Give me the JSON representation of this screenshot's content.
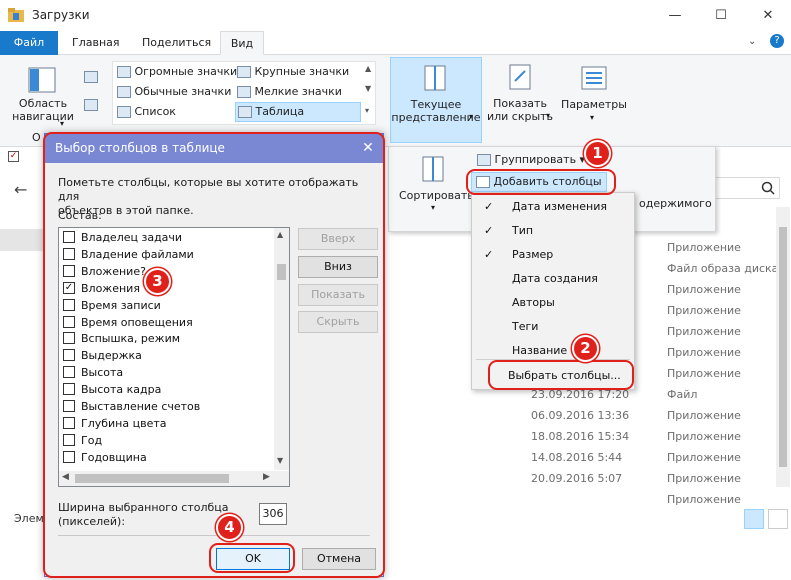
{
  "window": {
    "title": "Загрузки"
  },
  "tabs": [
    "Файл",
    "Главная",
    "Поделиться",
    "Вид"
  ],
  "ribbon": {
    "nav_pane": "Область\nнавигации",
    "nav_group_short": "О",
    "layouts": [
      "Огромные значки",
      "Крупные значки",
      "Обычные значки",
      "Мелкие значки",
      "Список",
      "Таблица"
    ],
    "current_view": "Текущее\nпредставление",
    "show_hide": "Показать\nили скрыть",
    "options": "Параметры"
  },
  "view_dropdown": {
    "sort": "Сортировать",
    "group": "Группировать",
    "add_columns": "Добавить столбцы",
    "contents_partial": "одержимого"
  },
  "menu": {
    "items": [
      {
        "label": "Дата изменения",
        "checked": true
      },
      {
        "label": "Тип",
        "checked": true
      },
      {
        "label": "Размер",
        "checked": true
      },
      {
        "label": "Дата создания",
        "checked": false
      },
      {
        "label": "Авторы",
        "checked": false
      },
      {
        "label": "Теги",
        "checked": false
      },
      {
        "label": "Название",
        "checked": false
      }
    ],
    "choose": "Выбрать столбцы..."
  },
  "files": {
    "types": [
      "Приложение",
      "Файл образа диска",
      "Приложение",
      "Приложение",
      "Приложение",
      "Приложение",
      "Приложение",
      "Файл",
      "Приложение",
      "Приложение",
      "Приложение",
      "Приложение",
      "Приложение"
    ],
    "dates": [
      "23.09.2016 17:20",
      "06.09.2016 13:36",
      "18.08.2016 15:34",
      "14.08.2016 5:44",
      "20.09.2016 5:07"
    ],
    "status_partial": "Элем"
  },
  "dialog": {
    "title": "Выбор столбцов в таблице",
    "instruction": "Пометьте столбцы, которые вы хотите отображать для\nобъектов в этой папке.",
    "list_label": "Состав:",
    "columns": [
      {
        "label": "Владелец задачи",
        "checked": false
      },
      {
        "label": "Владение файлами",
        "checked": false
      },
      {
        "label": "Вложение?",
        "checked": false
      },
      {
        "label": "Вложения",
        "checked": true
      },
      {
        "label": "Время записи",
        "checked": false
      },
      {
        "label": "Время оповещения",
        "checked": false
      },
      {
        "label": "Вспышка, режим",
        "checked": false
      },
      {
        "label": "Выдержка",
        "checked": false
      },
      {
        "label": "Высота",
        "checked": false
      },
      {
        "label": "Высота кадра",
        "checked": false
      },
      {
        "label": "Выставление счетов",
        "checked": false
      },
      {
        "label": "Глубина цвета",
        "checked": false
      },
      {
        "label": "Год",
        "checked": false
      },
      {
        "label": "Годовщина",
        "checked": false
      }
    ],
    "btn_up": "Вверх",
    "btn_down": "Вниз",
    "btn_show": "Показать",
    "btn_hide": "Скрыть",
    "width_label": "Ширина выбранного столбца\n(пикселей):",
    "width_value": "306",
    "ok": "OK",
    "cancel": "Отмена"
  },
  "badges": [
    "1",
    "2",
    "3",
    "4"
  ],
  "colors": {
    "accent": "#1979ca",
    "annotation": "#e0201a",
    "dialog_title": "#7a88d4"
  }
}
